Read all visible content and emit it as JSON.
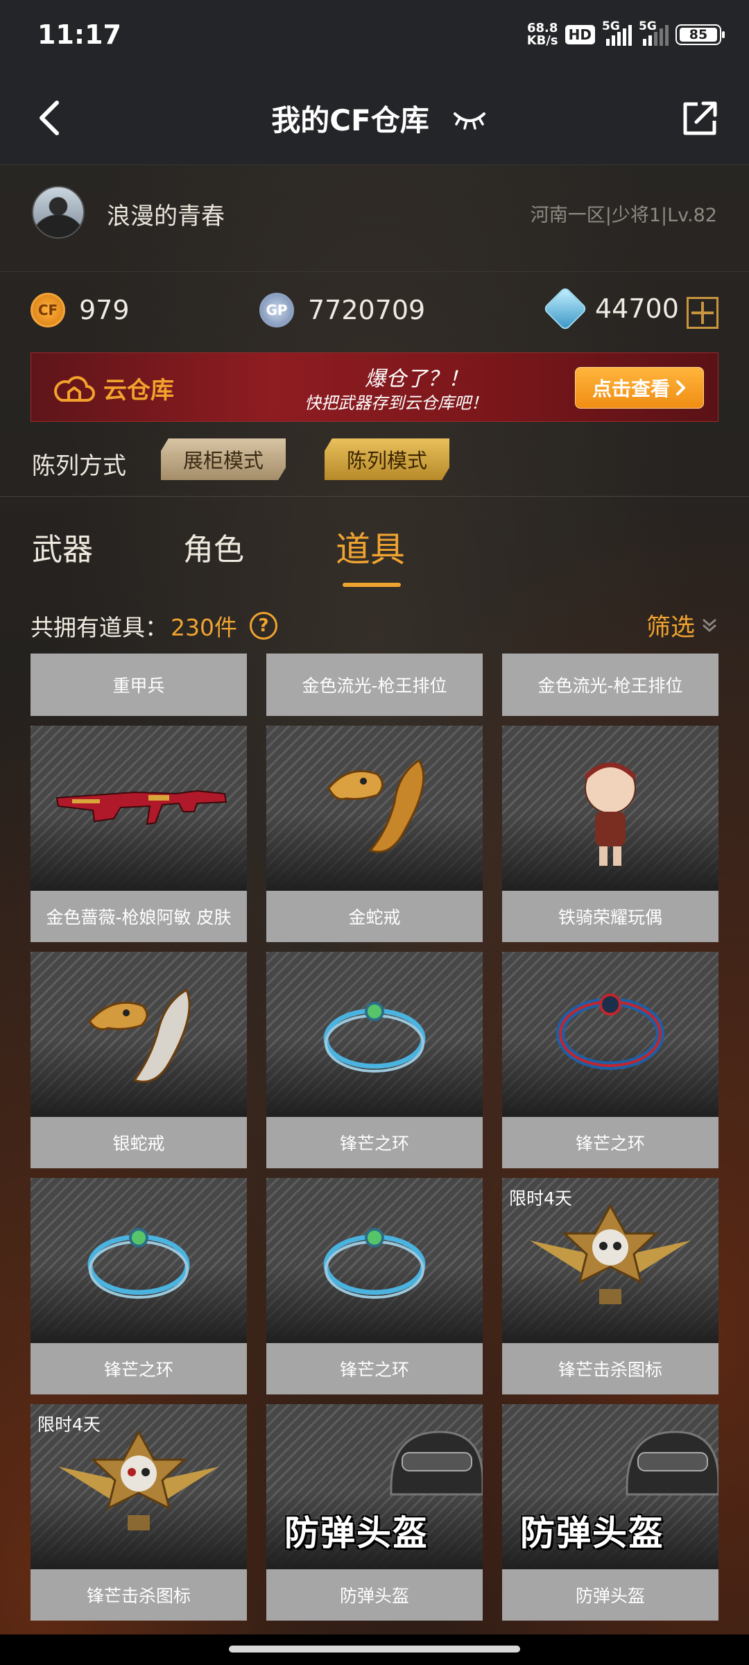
{
  "status": {
    "time": "11:17",
    "net_speed_top": "68.8",
    "net_speed_bottom": "KB/s",
    "hd": "HD",
    "sim1": "5G",
    "sim2": "5G",
    "battery": "85"
  },
  "header": {
    "title": "我的CF仓库"
  },
  "user": {
    "name": "浪漫的青春",
    "meta": "河南一区|少将1|Lv.82"
  },
  "currency": {
    "cf_icon_text": "CF",
    "cf_value": "979",
    "gp_icon_text": "GP",
    "gp_value": "7720709",
    "diamond_value": "44700"
  },
  "banner": {
    "tag": "云仓库",
    "line1": "爆仓了？！",
    "line2": "快把武器存到云仓库吧！",
    "button": "点击查看"
  },
  "display_mode": {
    "label": "陈列方式",
    "options": [
      "展柜模式",
      "陈列模式"
    ],
    "selected": "陈列模式"
  },
  "tabs": [
    "武器",
    "角色",
    "道具"
  ],
  "active_tab": "道具",
  "count": {
    "label": "共拥有道具：",
    "value": "230件"
  },
  "filter": {
    "label": "筛选"
  },
  "top_row_labels": [
    "重甲兵",
    "金色流光-枪王排位",
    "金色流光-枪王排位"
  ],
  "items": [
    {
      "name": "金色蔷薇-枪娘阿敏 皮肤",
      "icon": "rifle-skin"
    },
    {
      "name": "金蛇戒",
      "icon": "gold-snake-ring"
    },
    {
      "name": "铁骑荣耀玩偶",
      "icon": "doll"
    },
    {
      "name": "银蛇戒",
      "icon": "silver-snake-ring"
    },
    {
      "name": "锋芒之环",
      "icon": "ring-blue"
    },
    {
      "name": "锋芒之环",
      "icon": "ring-red-blue"
    },
    {
      "name": "锋芒之环",
      "icon": "ring-blue"
    },
    {
      "name": "锋芒之环",
      "icon": "ring-blue"
    },
    {
      "name": "锋芒击杀图标",
      "icon": "skull-emblem",
      "badge": "限时4天"
    },
    {
      "name": "锋芒击杀图标",
      "icon": "skull-emblem",
      "badge": "限时4天"
    },
    {
      "name": "防弹头盔",
      "icon": "helmet",
      "overlay": "防弹头盔"
    },
    {
      "name": "防弹头盔",
      "icon": "helmet",
      "overlay": "防弹头盔"
    }
  ],
  "colors": {
    "accent": "#f0a430",
    "bg": "#201d1b",
    "label_bg": "#a6a6a6"
  }
}
